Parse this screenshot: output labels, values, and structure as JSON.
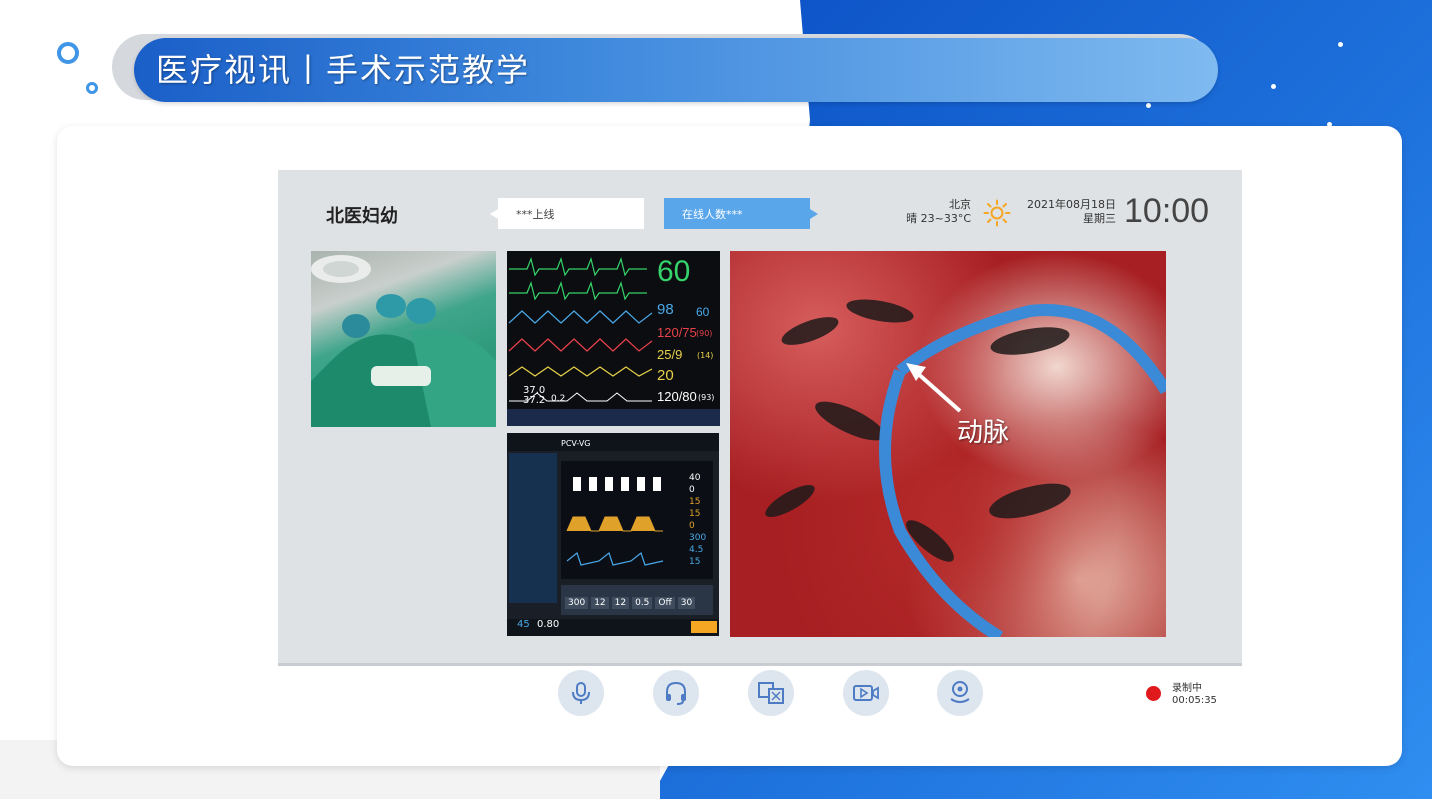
{
  "slide": {
    "title": "医疗视讯丨手术示范教学"
  },
  "screen": {
    "hospital": "北医妇幼",
    "online_notice": "***上线",
    "online_count": "在线人数***",
    "weather": {
      "city": "北京",
      "condition": "晴 23~33°C",
      "icon": "sun-icon"
    },
    "date": "2021年08月18日",
    "weekday": "星期三",
    "time": "10:00"
  },
  "videos": {
    "monitor": {
      "hr": "60",
      "spo2": "98",
      "pulse": "60",
      "nibp": "120/75",
      "nibp_extra": "(90)",
      "pa": "25/9",
      "pa_extra": "(14)",
      "rr": "20",
      "temp1": "37.0",
      "temp2": "37.2",
      "temp_diff": "0.2",
      "art": "120/80",
      "art_extra": "(93)"
    },
    "ventilator": {
      "mode": "PCV-VG",
      "values": [
        "300",
        "12",
        "12",
        "0.5",
        "Off",
        "30"
      ],
      "fio2": "0.80",
      "left_value": "45",
      "readouts": [
        "40",
        "0",
        "15",
        "15",
        "0",
        "300",
        "4.5",
        "15"
      ]
    },
    "surgery": {
      "annotation": "动脉"
    }
  },
  "controls": [
    {
      "name": "microphone-button",
      "icon": "microphone-icon"
    },
    {
      "name": "headset-button",
      "icon": "headset-icon"
    },
    {
      "name": "translate-button",
      "icon": "translate-icon"
    },
    {
      "name": "video-button",
      "icon": "video-icon"
    },
    {
      "name": "location-button",
      "icon": "location-icon"
    }
  ],
  "recording": {
    "label": "录制中",
    "time": "00:05:35",
    "color": "#e0191d"
  },
  "colors": {
    "accent": "#1a5fc8",
    "online_count_bg": "#5aa6ea"
  }
}
